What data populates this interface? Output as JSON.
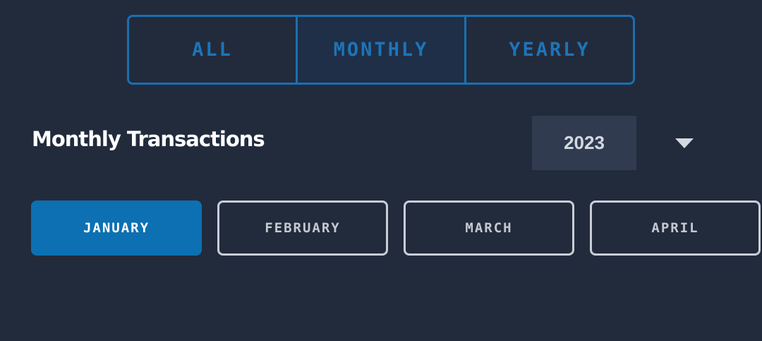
{
  "tabs": [
    {
      "label": "ALL",
      "active": false
    },
    {
      "label": "MONTHLY",
      "active": true
    },
    {
      "label": "YEARLY",
      "active": false
    }
  ],
  "header": {
    "title": "Monthly Transactions",
    "year_selected": "2023",
    "dropdown_icon": "chevron-down-icon"
  },
  "months": [
    {
      "label": "JANUARY",
      "selected": true
    },
    {
      "label": "FEBRUARY",
      "selected": false
    },
    {
      "label": "MARCH",
      "selected": false
    },
    {
      "label": "APRIL",
      "selected": false
    }
  ],
  "colors": {
    "background": "#222b3c",
    "accent": "#1a6fb0",
    "selected_month": "#0c70b2",
    "chip_border": "#c9ced6",
    "year_select_bg": "#303b50"
  }
}
